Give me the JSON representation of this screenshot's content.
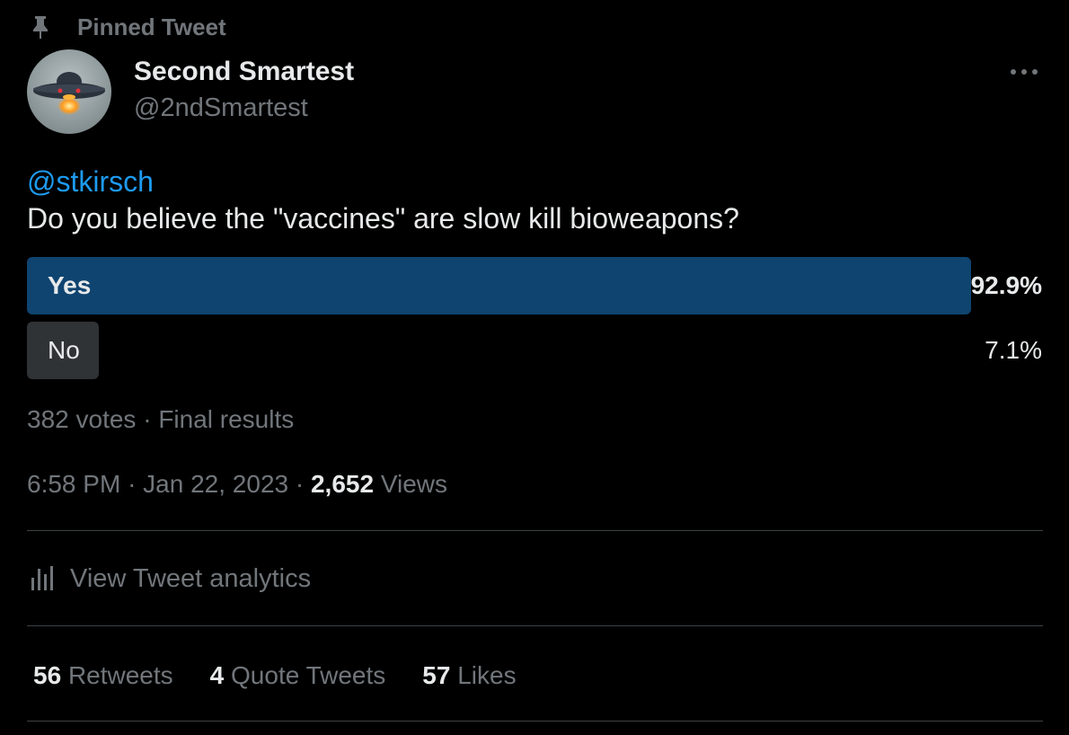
{
  "pinned": {
    "label": "Pinned Tweet",
    "icon": "pin-icon"
  },
  "author": {
    "display_name": "Second Smartest",
    "handle": "@2ndSmartest",
    "avatar_icon": "ufo-avatar"
  },
  "more_icon": "more-horizontal-icon",
  "tweet": {
    "mention": "@stkirsch",
    "text": "Do you believe the \"vaccines\" are slow kill bioweapons?"
  },
  "poll": {
    "options": [
      {
        "label": "Yes",
        "percent_text": "92.9%",
        "share": 0.929,
        "winner": true
      },
      {
        "label": "No",
        "percent_text": "7.1%",
        "share": 0.071,
        "winner": false
      }
    ],
    "votes_text": "382 votes",
    "separator": "·",
    "status_text": "Final results"
  },
  "meta": {
    "time": "6:58 PM",
    "separator": "·",
    "date": "Jan 22, 2023",
    "views_count": "2,652",
    "views_label": "Views"
  },
  "analytics": {
    "label": "View Tweet analytics",
    "icon": "bar-chart-icon"
  },
  "stats": [
    {
      "count": "56",
      "label": "Retweets"
    },
    {
      "count": "4",
      "label": "Quote Tweets"
    },
    {
      "count": "57",
      "label": "Likes"
    }
  ],
  "colors": {
    "background": "#000000",
    "text_primary": "#e7e9ea",
    "text_secondary": "#71767b",
    "link": "#1d9bf0",
    "poll_winner_bar": "#0f4470",
    "poll_other_bar": "#2f3336",
    "divider": "#3e4144"
  }
}
